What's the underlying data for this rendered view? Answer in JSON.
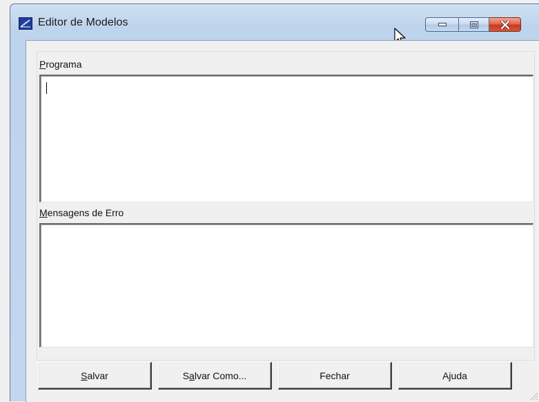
{
  "window": {
    "title": "Editor de Modelos",
    "caption_buttons": [
      "minimize",
      "maximize",
      "close"
    ]
  },
  "program": {
    "label_mnemonic": "P",
    "label_rest": "rograma",
    "value": ""
  },
  "errors": {
    "label_mnemonic": "M",
    "label_rest": "ensagens de Erro",
    "value": ""
  },
  "buttons": {
    "save": {
      "pre": "",
      "mnemonic": "S",
      "post": "alvar"
    },
    "save_as": {
      "pre": "S",
      "mnemonic": "a",
      "post": "lvar Como..."
    },
    "close": {
      "label": "Fechar"
    },
    "help": {
      "label": "Ajuda"
    }
  },
  "icons": {
    "app": "model-editor-icon",
    "pointer": "mouse-pointer-icon",
    "minimize": "minimize-icon",
    "maximize": "maximize-icon",
    "close": "close-icon",
    "grip": "resize-grip-icon"
  }
}
